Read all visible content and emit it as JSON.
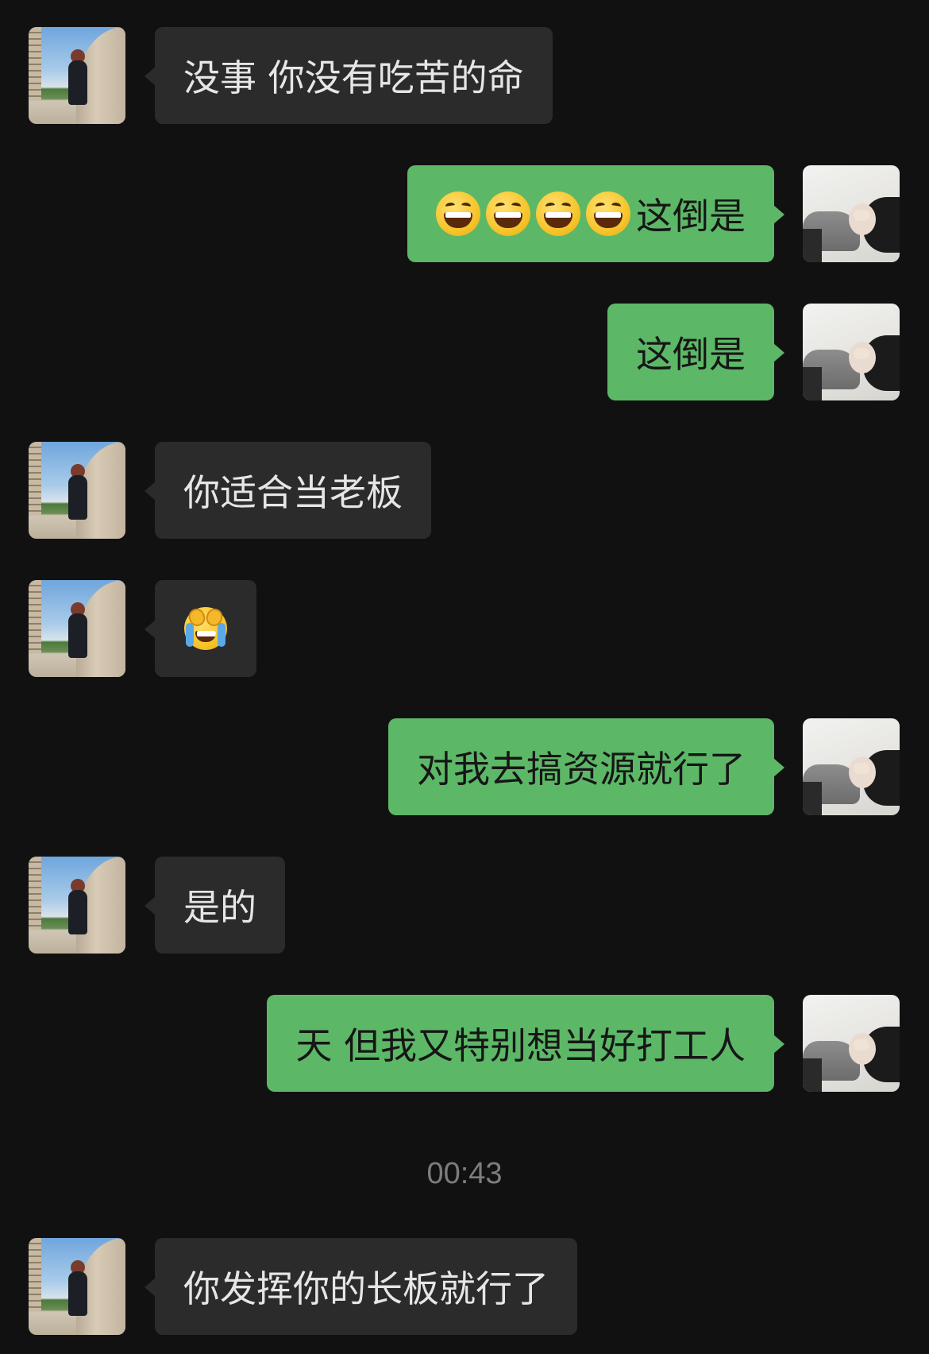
{
  "messages": [
    {
      "side": "left",
      "text": "没事 你没有吃苦的命"
    },
    {
      "side": "right",
      "text": "这倒是",
      "emoji": "grinning-face-icon",
      "emoji_count": 4
    },
    {
      "side": "right",
      "text": "这倒是"
    },
    {
      "side": "left",
      "text": "你适合当老板"
    },
    {
      "side": "left",
      "emoji": "loudly-crying-face-icon"
    },
    {
      "side": "right",
      "text": "对我去搞资源就行了"
    },
    {
      "side": "left",
      "text": "是的"
    },
    {
      "side": "right",
      "text": "天 但我又特别想当好打工人"
    },
    {
      "side": "left",
      "text": "你发挥你的长板就行了"
    }
  ],
  "timestamp": "00:43",
  "colors": {
    "background": "#111111",
    "incoming_bubble": "#2b2b2b",
    "outgoing_bubble": "#5cb867",
    "incoming_text": "#e6e6e6",
    "outgoing_text": "#161616",
    "timestamp_text": "#7d7d7d"
  }
}
